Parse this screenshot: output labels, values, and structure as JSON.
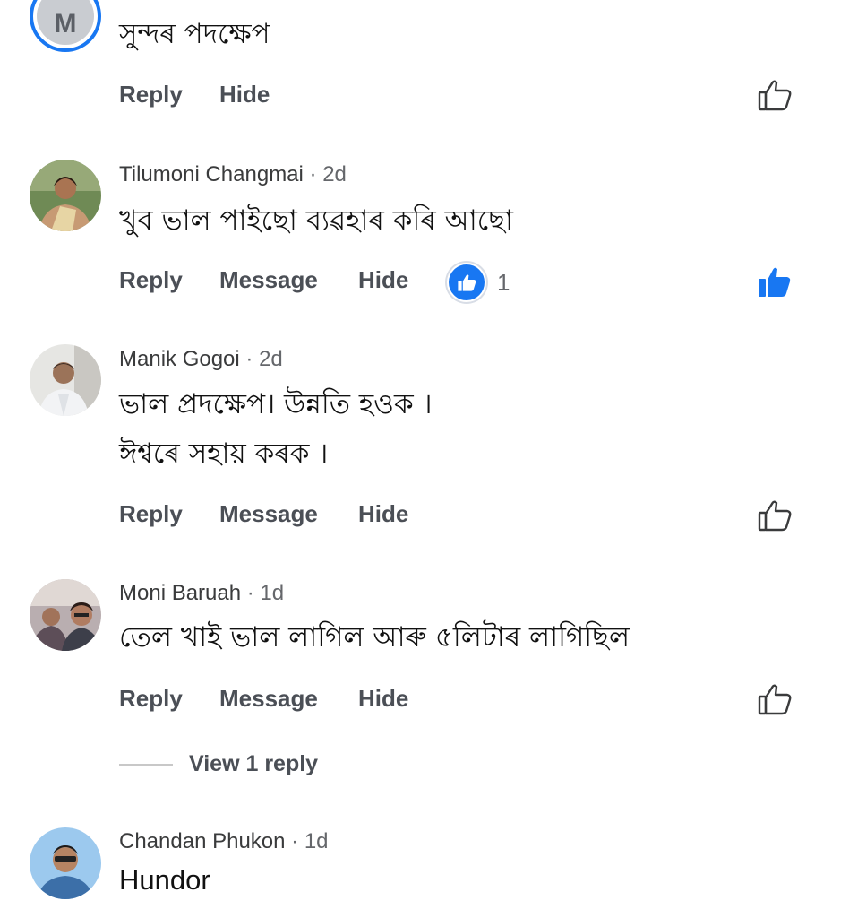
{
  "comments": [
    {
      "text": "সুন্দৰ পদক্ষেপ",
      "avatar_letter": "M",
      "actions": {
        "reply": "Reply",
        "hide": "Hide"
      }
    },
    {
      "author": "Tilumoni Changmai",
      "time": "· 2d",
      "text": "খুব ভাল পাইছো ব্যৱহাৰ কৰি আছো",
      "actions": {
        "reply": "Reply",
        "message": "Message",
        "hide": "Hide"
      },
      "reaction_count": "1",
      "liked": true
    },
    {
      "author": "Manik Gogoi",
      "time": "· 2d",
      "text_line1": "ভাল প্ৰদক্ষেপ।  উন্নতি হওক ।",
      "text_line2": "ঈশ্বৰে সহায় কৰক ।",
      "actions": {
        "reply": "Reply",
        "message": "Message",
        "hide": "Hide"
      }
    },
    {
      "author": "Moni Baruah",
      "time": "· 1d",
      "text": "তেল খাই ভাল লাগিল আৰু ৫লিটাৰ লাগিছিল",
      "actions": {
        "reply": "Reply",
        "message": "Message",
        "hide": "Hide"
      },
      "view_replies": "View 1 reply"
    },
    {
      "author": "Chandan Phukon",
      "time": "· 1d",
      "text": "Hundor"
    }
  ],
  "icons": {
    "like": "thumbs-up-outline-icon",
    "liked": "thumbs-up-filled-icon"
  },
  "colors": {
    "accent": "#1877f2",
    "action_text": "#4b4f56",
    "meta_text": "#65676b"
  }
}
